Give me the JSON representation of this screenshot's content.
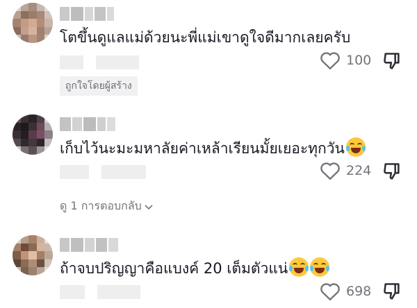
{
  "comments": [
    {
      "text": "โตขึ้นดูแลแม่ด้วยนะพี่แม่เขาดูใจดีมากเลยครับ",
      "likes": "100",
      "creator_liked_label": "ถูกใจโดยผู้สร้าง"
    },
    {
      "text": "เก็บไว้นะมะมหาลัยค่าเหล้าเรียนมั้ยเยอะทุกวัน",
      "likes": "224",
      "view_replies_label": "ดู 1 การตอบกลับ"
    },
    {
      "text": "ถ้าจบปริญญาคือแบงค์ 20 เต็มตัวแน่",
      "likes": "698"
    }
  ],
  "icons": {
    "like": "heart-outline-icon",
    "dislike": "thumbs-down-outline-icon",
    "emoji": "face-with-tears-of-joy-emoji",
    "expand": "chevron-down-icon"
  },
  "colors": {
    "text": "#161823",
    "muted": "#73747b",
    "badge_bg": "#f1f1f2"
  }
}
